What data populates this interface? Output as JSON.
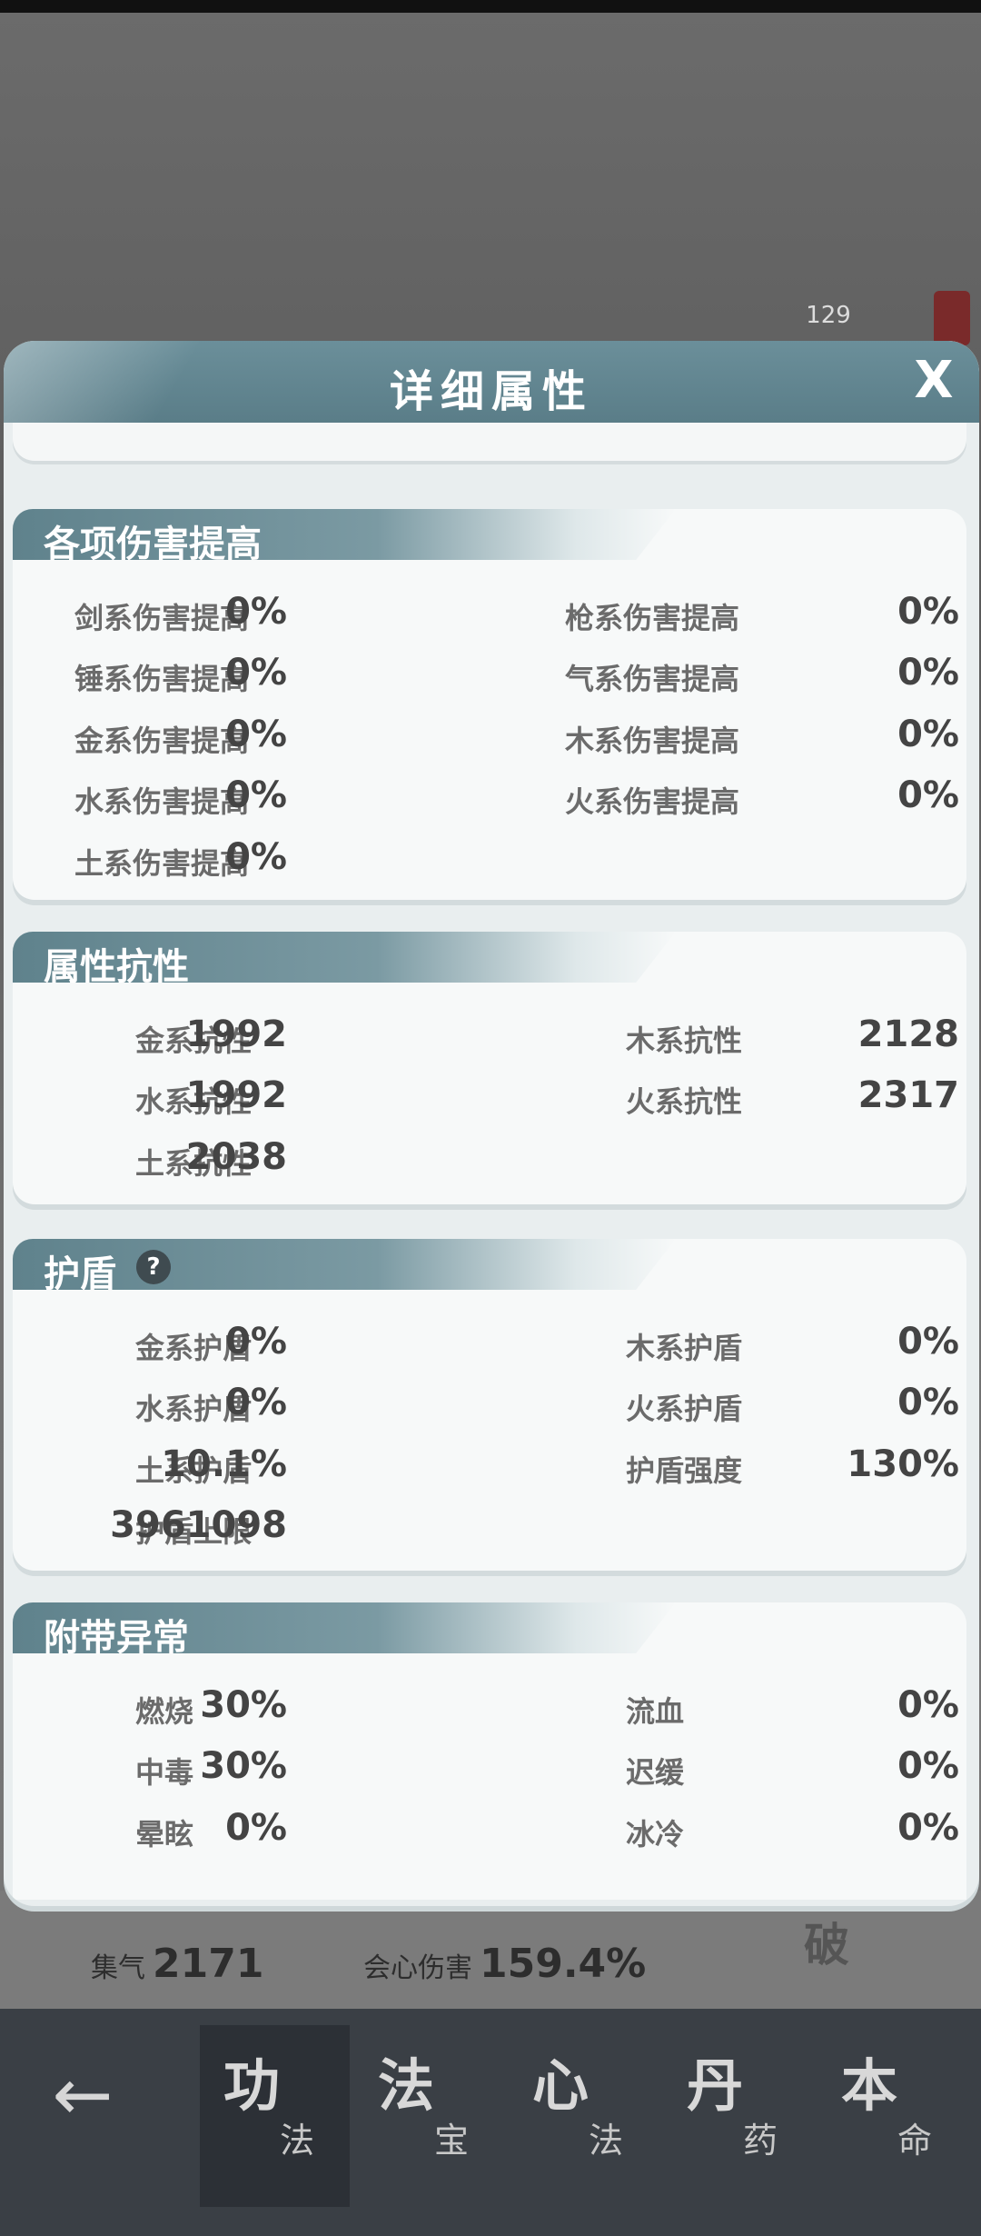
{
  "background": {
    "badge": "129",
    "stats": [
      {
        "icon": "集气",
        "value": "2171"
      },
      {
        "icon": "会心伤害",
        "value": "159.4%"
      }
    ],
    "stamp": "破"
  },
  "dialog": {
    "title": "详细属性",
    "close_label": "X"
  },
  "sections": {
    "damage": {
      "title": "各项伤害提高",
      "items": [
        {
          "label": "剑系伤害提高",
          "value": "0%"
        },
        {
          "label": "枪系伤害提高",
          "value": "0%"
        },
        {
          "label": "锤系伤害提高",
          "value": "0%"
        },
        {
          "label": "气系伤害提高",
          "value": "0%"
        },
        {
          "label": "金系伤害提高",
          "value": "0%"
        },
        {
          "label": "木系伤害提高",
          "value": "0%"
        },
        {
          "label": "水系伤害提高",
          "value": "0%"
        },
        {
          "label": "火系伤害提高",
          "value": "0%"
        },
        {
          "label": "土系伤害提高",
          "value": "0%"
        }
      ]
    },
    "resist": {
      "title": "属性抗性",
      "items": [
        {
          "label": "金系抗性",
          "value": "1992"
        },
        {
          "label": "木系抗性",
          "value": "2128"
        },
        {
          "label": "水系抗性",
          "value": "1992"
        },
        {
          "label": "火系抗性",
          "value": "2317"
        },
        {
          "label": "土系抗性",
          "value": "2038"
        }
      ]
    },
    "shield": {
      "title": "护盾",
      "help": "?",
      "items": [
        {
          "label": "金系护盾",
          "value": "0%"
        },
        {
          "label": "木系护盾",
          "value": "0%"
        },
        {
          "label": "水系护盾",
          "value": "0%"
        },
        {
          "label": "火系护盾",
          "value": "0%"
        },
        {
          "label": "土系护盾",
          "value": "10.1%"
        },
        {
          "label": "护盾强度",
          "value": "130%"
        },
        {
          "label": "护盾上限",
          "value": "3961098"
        }
      ]
    },
    "abnormal": {
      "title": "附带异常",
      "items": [
        {
          "label": "燃烧",
          "value": "30%"
        },
        {
          "label": "流血",
          "value": "0%"
        },
        {
          "label": "中毒",
          "value": "30%"
        },
        {
          "label": "迟缓",
          "value": "0%"
        },
        {
          "label": "晕眩",
          "value": "0%"
        },
        {
          "label": "冰冷",
          "value": "0%"
        }
      ]
    }
  },
  "nav": {
    "back_icon": "arrow-left",
    "tabs": [
      {
        "big": "功",
        "small": "法"
      },
      {
        "big": "法",
        "small": "宝"
      },
      {
        "big": "心",
        "small": "法"
      },
      {
        "big": "丹",
        "small": "药"
      },
      {
        "big": "本",
        "small": "命"
      }
    ]
  }
}
